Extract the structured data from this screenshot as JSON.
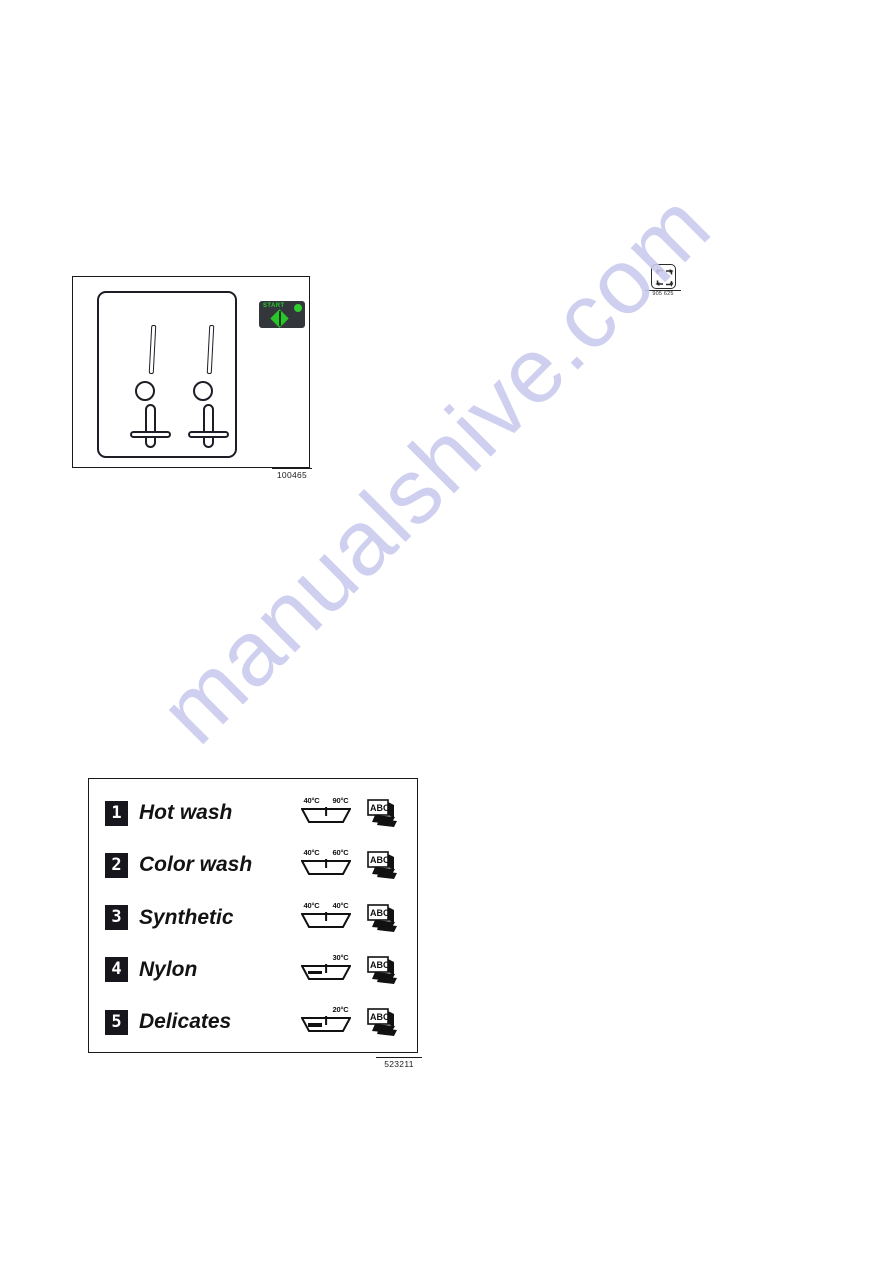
{
  "watermark": {
    "text": "manualshive.com",
    "color": "#c9c9ef"
  },
  "colors": {
    "ink": "#1a1a1a",
    "panel_outline": "#1d1d26",
    "start_button_bg": "#33373b",
    "start_green": "#2bc52b",
    "led_green": "#2fce2f",
    "num_badge_bg": "#16161c"
  },
  "figure_control_panel": {
    "caption": "100465",
    "start_button": {
      "label": "START",
      "led_name": "status-led",
      "symbol": "green-diamond"
    },
    "sliders": [
      {
        "name": "dispenser-slider-left"
      },
      {
        "name": "dispenser-slider-right"
      }
    ]
  },
  "icon_cycle": {
    "icon_name": "cycle-rotation-icon",
    "caption": "905 625"
  },
  "figure_program_list": {
    "caption": "523211",
    "programs": [
      {
        "number": "1",
        "name": "Hot wash",
        "temp_left": "40°C",
        "temp_right": "90°C",
        "tub_style": "divided",
        "care_icon": "abc-panels-icon"
      },
      {
        "number": "2",
        "name": "Color wash",
        "temp_left": "40°C",
        "temp_right": "60°C",
        "tub_style": "divided",
        "care_icon": "abc-panels-icon"
      },
      {
        "number": "3",
        "name": "Synthetic",
        "temp_left": "40°C",
        "temp_right": "40°C",
        "tub_style": "divided",
        "care_icon": "abc-panels-icon"
      },
      {
        "number": "4",
        "name": "Nylon",
        "temp_left": "",
        "temp_right": "30°C",
        "tub_style": "barred",
        "care_icon": "abc-panels-icon"
      },
      {
        "number": "5",
        "name": "Delicates",
        "temp_left": "",
        "temp_right": "20°C",
        "tub_style": "barred",
        "care_icon": "abc-panels-icon"
      }
    ]
  }
}
